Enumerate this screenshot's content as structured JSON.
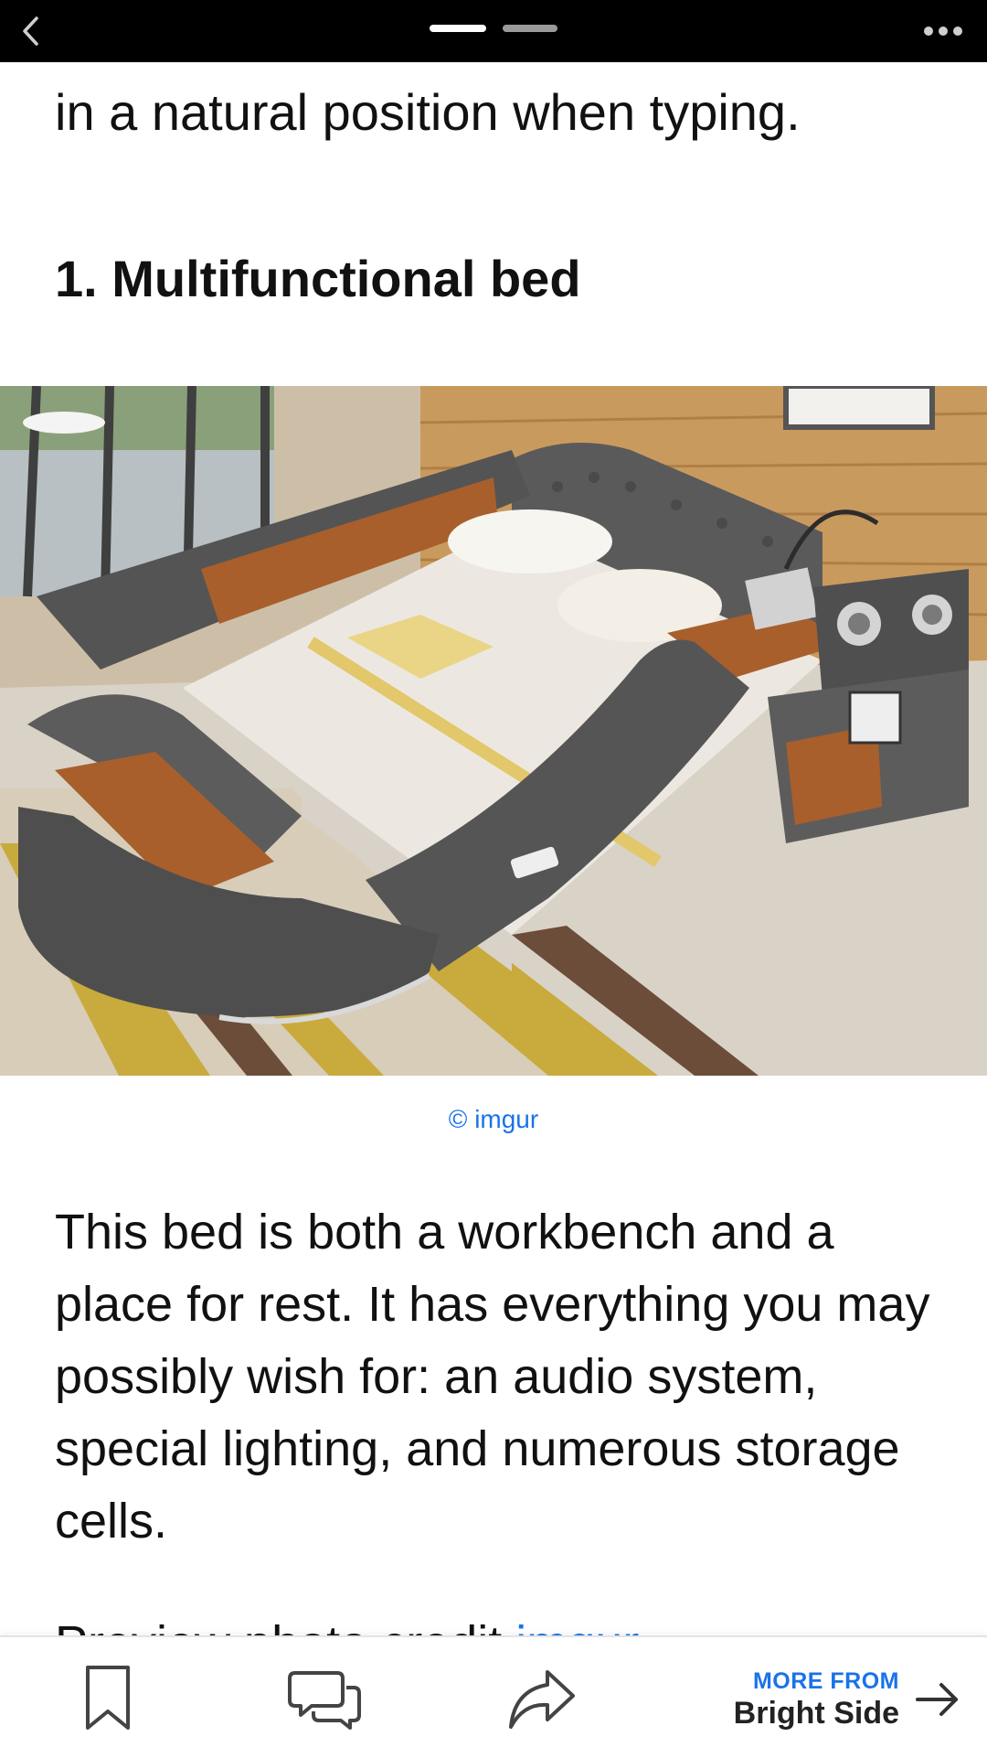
{
  "top_bar": {
    "back_icon": "chevron-left-icon",
    "pager_icon": "page-indicator",
    "more_icon": "ellipsis-icon"
  },
  "article": {
    "intro_tail": "in a natural position when typing.",
    "section_heading": "1. Multifunctional bed",
    "image_alt": "Gray upholstered multifunctional bed with built-in shelves, desk, speakers and lamp",
    "image_credit": "© imgur",
    "body_text": "This bed is both a workbench and a place for rest. It has everything you may possibly wish for: an audio system, special lighting, and numerous storage cells.",
    "next_line_prefix": "Preview photo credit ",
    "next_line_link": "imgur"
  },
  "bottom_bar": {
    "bookmark_icon": "bookmark-icon",
    "comments_icon": "comments-icon",
    "share_icon": "share-icon",
    "more_from_label": "MORE FROM",
    "more_from_source": "Bright Side",
    "arrow_icon": "arrow-right-icon"
  },
  "colors": {
    "top_bar": "#000000",
    "link": "#1a73e8",
    "text": "#111111"
  }
}
